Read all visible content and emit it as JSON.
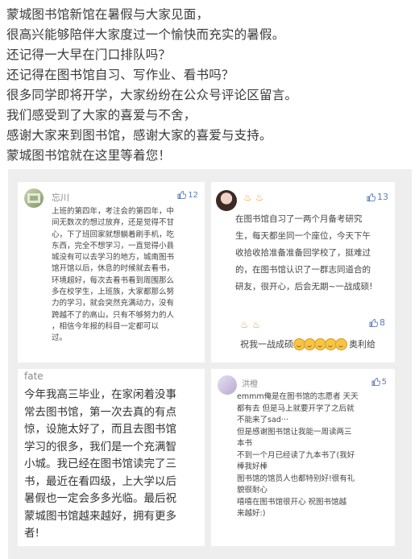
{
  "intro": [
    "蒙城图书馆新馆在暑假与大家见面，",
    "很高兴能够陪伴大家度过一个愉快而充实的暑假。",
    "还记得一大早在门口排队吗？",
    "还记得在图书馆自习、写作业、看书吗？",
    "很多同学即将开学，大家纷纷在公众号评论区留言。",
    "我们感受到了大家的喜爱与不舍，",
    "感谢大家来到图书馆，感谢大家的喜爱与支持。",
    "蒙城图书馆就在这里等着您！"
  ],
  "comments": [
    {
      "user": "忘川",
      "likes": "12",
      "lines": [
        "上班的第四年，考注会的第四年，中",
        "间无数次的想过放弃，还是觉得不甘",
        "心，下了班回家就想躺着刷手机，吃",
        "东西，完全不想学习，一直觉得小县",
        "城没有可以去学习的地方，城南图书",
        "馆开馆以后，休息的时候就去看书，",
        "环境超好，每次去看书看到周围那么",
        "多在校学生，上班族，大家都那么努",
        "力的学习，就会突然充满动力，没有",
        "跨越不了的高山，只有不够努力的人",
        "，相信今年报的科目一定都可以",
        "过。"
      ]
    },
    {
      "user": "",
      "likes": "13",
      "lines": [
        "在图书馆自习了一两个月备考研究",
        "生，每天都坐同一个座位，今天下午",
        "收拾收拾准备准备回学校了，挺难过",
        "的，在图书馆认识了一群志同道合的",
        "研友，很开心，后会无期~一战成硕!"
      ],
      "reply_likes": "8",
      "reply_prefix": "祝我一战成硕",
      "reply_suffix": "奥利给"
    },
    {
      "user": "fate",
      "likes": "",
      "lines": [
        "今年我高三毕业，在家闲着没事",
        "常去图书馆，第一次去真的有点",
        "惊，设施太好了，而且去图书馆",
        "学习的很多，我们是一个充满智",
        "小城。我已经在图书馆读完了三",
        "书，最近在看四级，上大学以后",
        "暑假也一定会多多光临。最后祝",
        "蒙城图书馆越来越好，拥有更多",
        "者!"
      ]
    },
    {
      "user": "洪橙",
      "likes": "5",
      "lines": [
        "emmm俺是在图书馆的志愿者 天天",
        "都有去 但是马上就要开学了之后就",
        "不能来了sad···",
        "但是感谢图书馆让我能一周读两三",
        "本书",
        "不到一个月已经读了九本书了(我好",
        "棒我好棒",
        "图书馆的馆员人也都特别好!很有礼",
        "貌很耐心",
        "嘻嘻在图书馆很开心  祝图书馆越",
        "来越好:)"
      ]
    }
  ],
  "colors": {
    "accent": "#5b7fb8",
    "fire": "#f0a030",
    "board": "#eeeeee"
  },
  "icons": [
    "thumbs-up-icon",
    "fire-icon",
    "smile-emoji-icon",
    "avatar"
  ]
}
